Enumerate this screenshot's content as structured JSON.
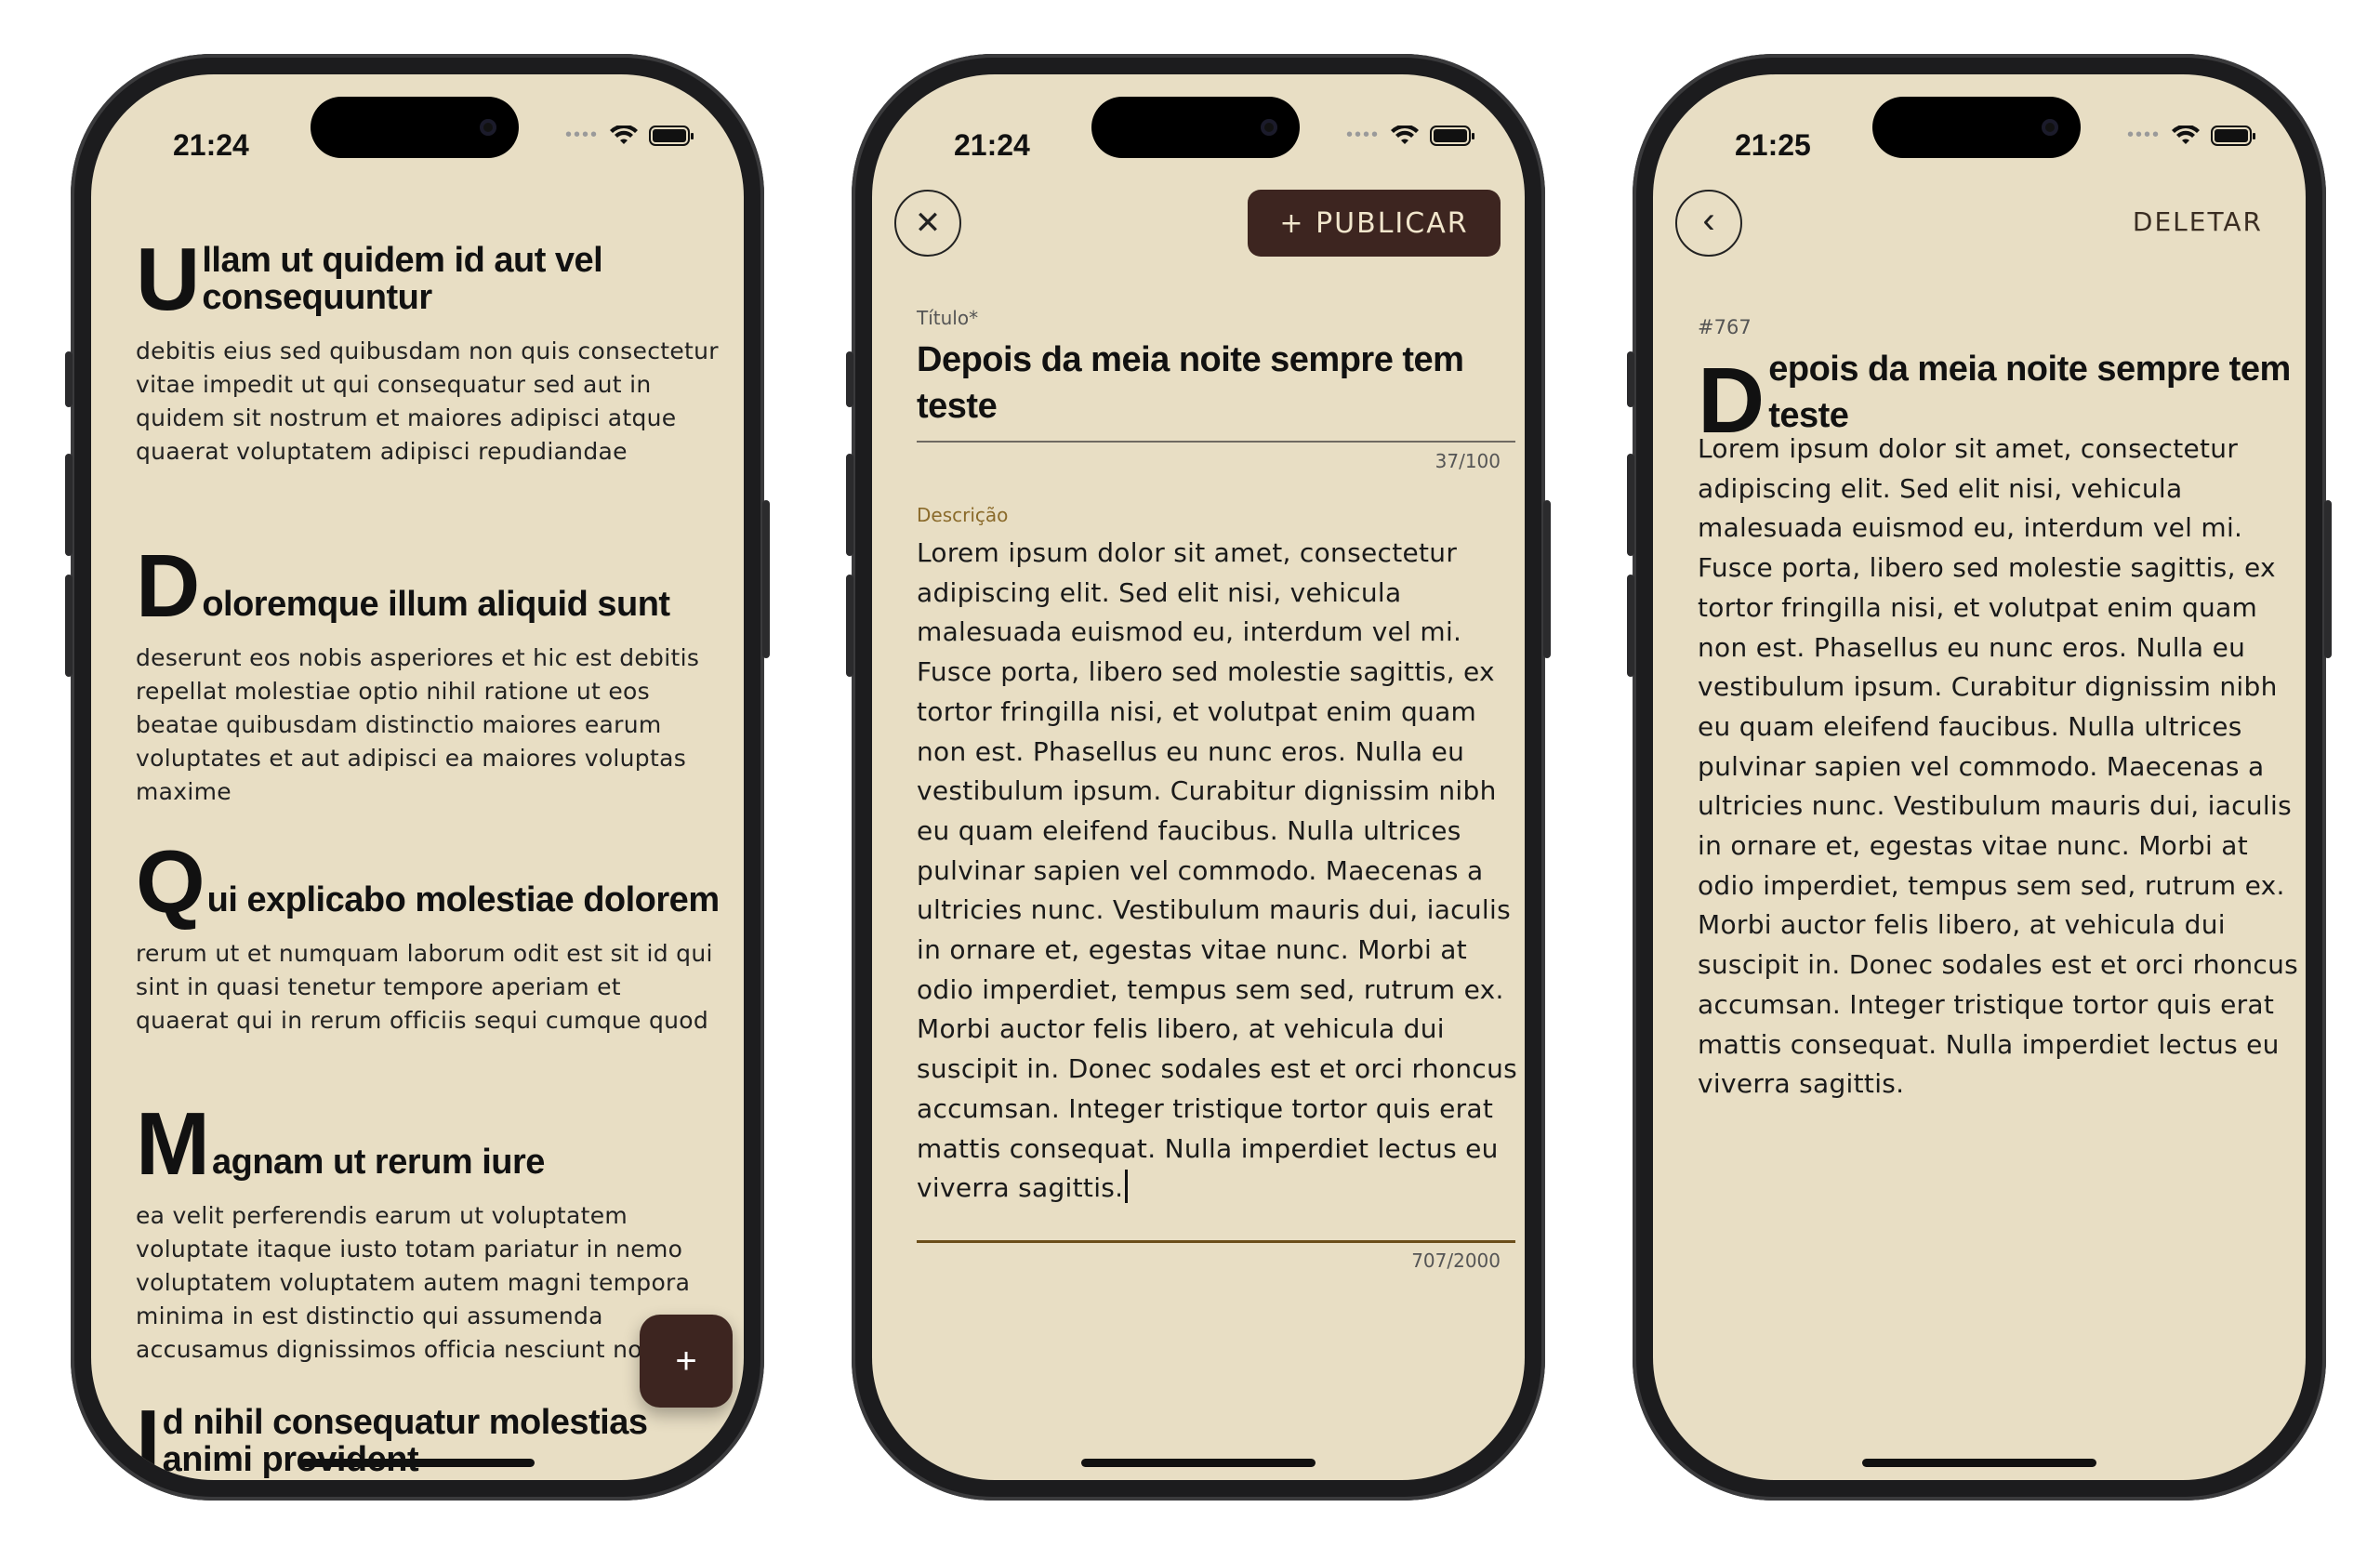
{
  "screens": {
    "list": {
      "time": "21:24",
      "articles": [
        {
          "cap": "U",
          "title": "llam ut quidem id aut vel consequuntur",
          "body": "debitis eius sed quibusdam non quis consectetur vitae impedit ut qui consequatur sed aut in quidem sit nostrum et maiores adipisci atque quaerat voluptatem adipisci repudiandae"
        },
        {
          "cap": "D",
          "title": "oloremque illum aliquid sunt",
          "body": "deserunt eos nobis asperiores et hic est debitis repellat molestiae optio nihil ratione ut eos beatae quibusdam distinctio maiores earum voluptates et aut adipisci ea maiores voluptas maxime"
        },
        {
          "cap": "Q",
          "title": "ui explicabo molestiae dolorem",
          "body": "rerum ut et numquam laborum odit est sit id qui sint in quasi tenetur tempore aperiam et quaerat qui in rerum officiis sequi cumque quod"
        },
        {
          "cap": "M",
          "title": "agnam ut rerum iure",
          "body": "ea velit perferendis earum ut voluptatem voluptate itaque iusto totam pariatur in nemo voluptatem voluptatem autem magni tempora minima in est distinctio qui assumenda accusamus dignissimos officia nesciunt nobis"
        },
        {
          "cap": "I",
          "title": "d nihil consequatur molestias animi provident",
          "body": ""
        }
      ],
      "fab_label": "+"
    },
    "editor": {
      "time": "21:24",
      "close_label": "✕",
      "publish_label": "+ PUBLICAR",
      "title_label": "Título*",
      "title_value": "Depois da meia noite sempre tem teste",
      "title_counter": "37/100",
      "desc_label": "Descrição",
      "desc_value": "Lorem ipsum dolor sit amet, consectetur adipiscing elit. Sed elit nisi, vehicula malesuada euismod eu, interdum vel mi. Fusce porta, libero sed molestie sagittis, ex tortor fringilla nisi, et volutpat enim quam non est. Phasellus eu nunc eros. Nulla eu vestibulum ipsum. Curabitur dignissim nibh eu quam eleifend faucibus. Nulla ultrices pulvinar sapien vel commodo. Maecenas a ultricies nunc. Vestibulum mauris dui, iaculis in ornare et, egestas vitae nunc. Morbi at odio imperdiet, tempus sem sed, rutrum ex. Morbi auctor felis libero, at vehicula dui suscipit in. Donec sodales est et orci rhoncus accumsan. Integer tristique tortor quis erat mattis consequat. Nulla imperdiet lectus eu viverra sagittis.",
      "desc_counter": "707/2000"
    },
    "detail": {
      "time": "21:25",
      "back_label": "‹",
      "delete_label": "DELETAR",
      "id_label": "#767",
      "cap": "D",
      "title": "epois da meia noite sempre tem teste",
      "body": "Lorem ipsum dolor sit amet, consectetur adipiscing elit. Sed elit nisi, vehicula malesuada euismod eu, interdum vel mi. Fusce porta, libero sed molestie sagittis, ex tortor fringilla nisi, et volutpat enim quam non est. Phasellus eu nunc eros. Nulla eu vestibulum ipsum. Curabitur dignissim nibh eu quam eleifend faucibus. Nulla ultrices pulvinar sapien vel commodo. Maecenas a ultricies nunc. Vestibulum mauris dui, iaculis in ornare et, egestas vitae nunc. Morbi at odio imperdiet, tempus sem sed, rutrum ex. Morbi auctor felis libero, at vehicula dui suscipit in. Donec sodales est et orci rhoncus accumsan. Integer tristique tortor quis erat mattis consequat. Nulla imperdiet lectus eu viverra sagittis."
    }
  },
  "theme": {
    "background": "#e8dec4",
    "accent": "#3d2520",
    "focus": "#6b4e1a"
  },
  "icons": {
    "signal": "cellular-signal-icon",
    "wifi": "wifi-icon",
    "battery": "battery-icon",
    "close": "close-icon",
    "back": "chevron-left-icon",
    "add": "plus-icon"
  }
}
